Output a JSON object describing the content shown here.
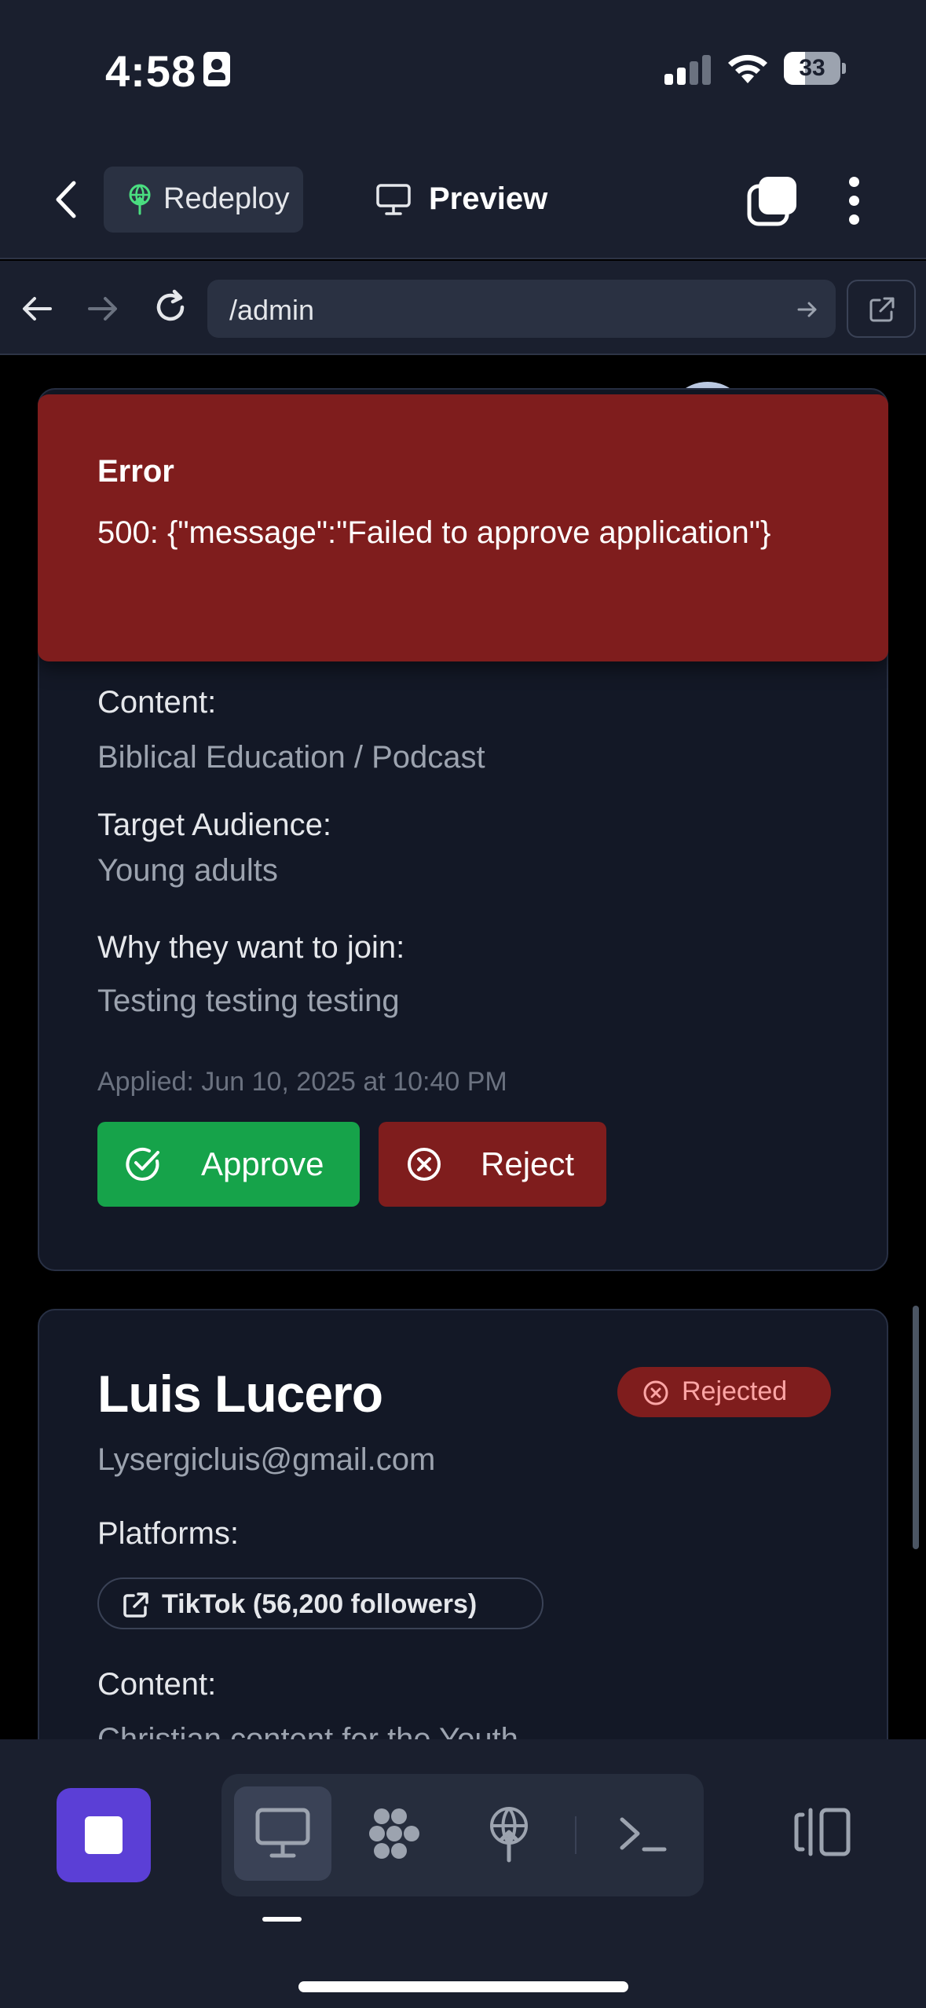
{
  "status_bar": {
    "time": "4:58",
    "battery": "33"
  },
  "app_bar": {
    "redeploy_label": "Redeploy",
    "preview_label": "Preview"
  },
  "url_bar": {
    "url": "/admin"
  },
  "error_toast": {
    "title": "Error",
    "message": "500: {\"message\":\"Failed to approve application\"}"
  },
  "application_1": {
    "content_label": "Content:",
    "content_value": "Biblical Education / Podcast",
    "audience_label": "Target Audience:",
    "audience_value": "Young adults",
    "why_label": "Why they want to join:",
    "why_value": "Testing testing testing",
    "applied": "Applied: Jun 10, 2025 at 10:40 PM",
    "approve_label": "Approve",
    "reject_label": "Reject"
  },
  "application_2": {
    "name": "Luis Lucero",
    "status": "Rejected",
    "email": "Lysergicluis@gmail.com",
    "platforms_label": "Platforms:",
    "platforms": [
      "TikTok (56,200 followers)"
    ],
    "content_label": "Content:",
    "content_value": "Christian content for the Youth"
  },
  "colors": {
    "approve": "#16a34a",
    "reject": "#7f1d1d",
    "toast": "#7f1d1d",
    "accent": "#5b3fd6"
  },
  "bottom_bar": {
    "items": [
      "desktop-icon",
      "agent-icon",
      "deploy-icon",
      "terminal-icon"
    ],
    "active": "desktop-icon"
  }
}
